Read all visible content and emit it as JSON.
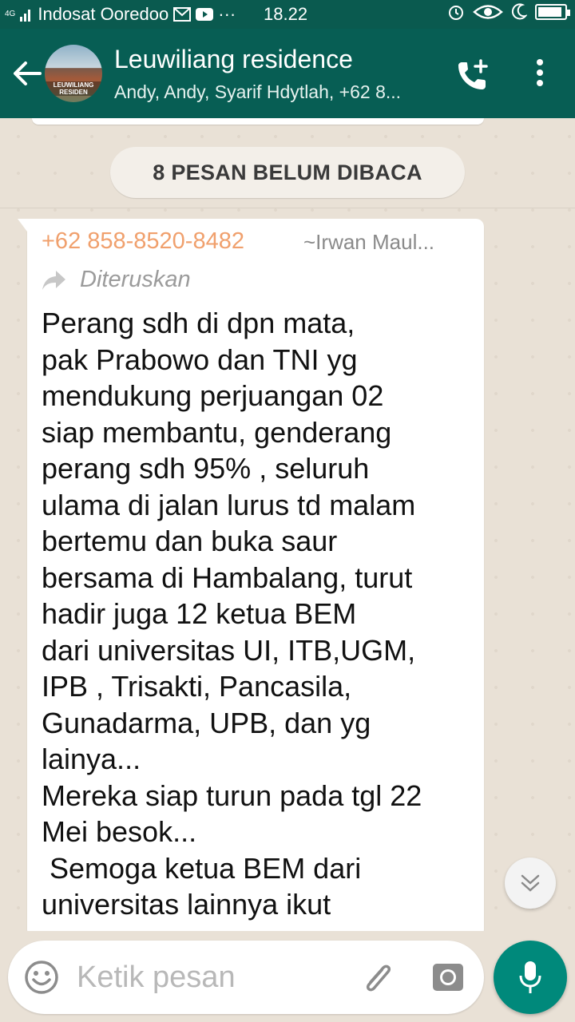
{
  "status_bar": {
    "network": "4G",
    "carrier": "Indosat Ooredoo",
    "dots": "···",
    "time": "18.22",
    "battery_level": 0.9
  },
  "header": {
    "group_name": "Leuwiliang residence",
    "members": "Andy, Andy, Syarif Hdytlah, +62 8...",
    "avatar_text": "LEUWILIANG RESIDEN",
    "icons": [
      "back-arrow-icon",
      "add-call-icon",
      "more-vert-icon"
    ]
  },
  "chat": {
    "unread_banner": "8 PESAN BELUM DIBACA",
    "message": {
      "sender_phone": "+62 858-8520-8482",
      "sender_name": "~Irwan Maul...",
      "forwarded_label": "Diteruskan",
      "text": "Perang sdh di dpn mata,\npak Prabowo dan TNI yg\nmendukung perjuangan 02\nsiap membantu, genderang\nperang sdh 95% , seluruh\nulama di jalan lurus td malam\nbertemu dan buka saur\nbersama di Hambalang, turut\nhadir juga 12 ketua BEM\ndari universitas UI, ITB,UGM,\nIPB , Trisakti, Pancasila,\nGunadarma, UPB, dan yg\nlainya...\nMereka siap turun pada tgl 22\nMei besok...\n Semoga ketua BEM dari\nuniversitas lainnya ikut"
    }
  },
  "composer": {
    "placeholder": "Ketik pesan",
    "icons": [
      "emoji-icon",
      "attach-icon",
      "camera-icon",
      "mic-icon"
    ]
  },
  "colors": {
    "header": "#075e54",
    "status_bar": "#0a5a4f",
    "sender_phone": "#f0a06d",
    "mic_button": "#00897b",
    "chat_background": "#e9e1d6"
  }
}
